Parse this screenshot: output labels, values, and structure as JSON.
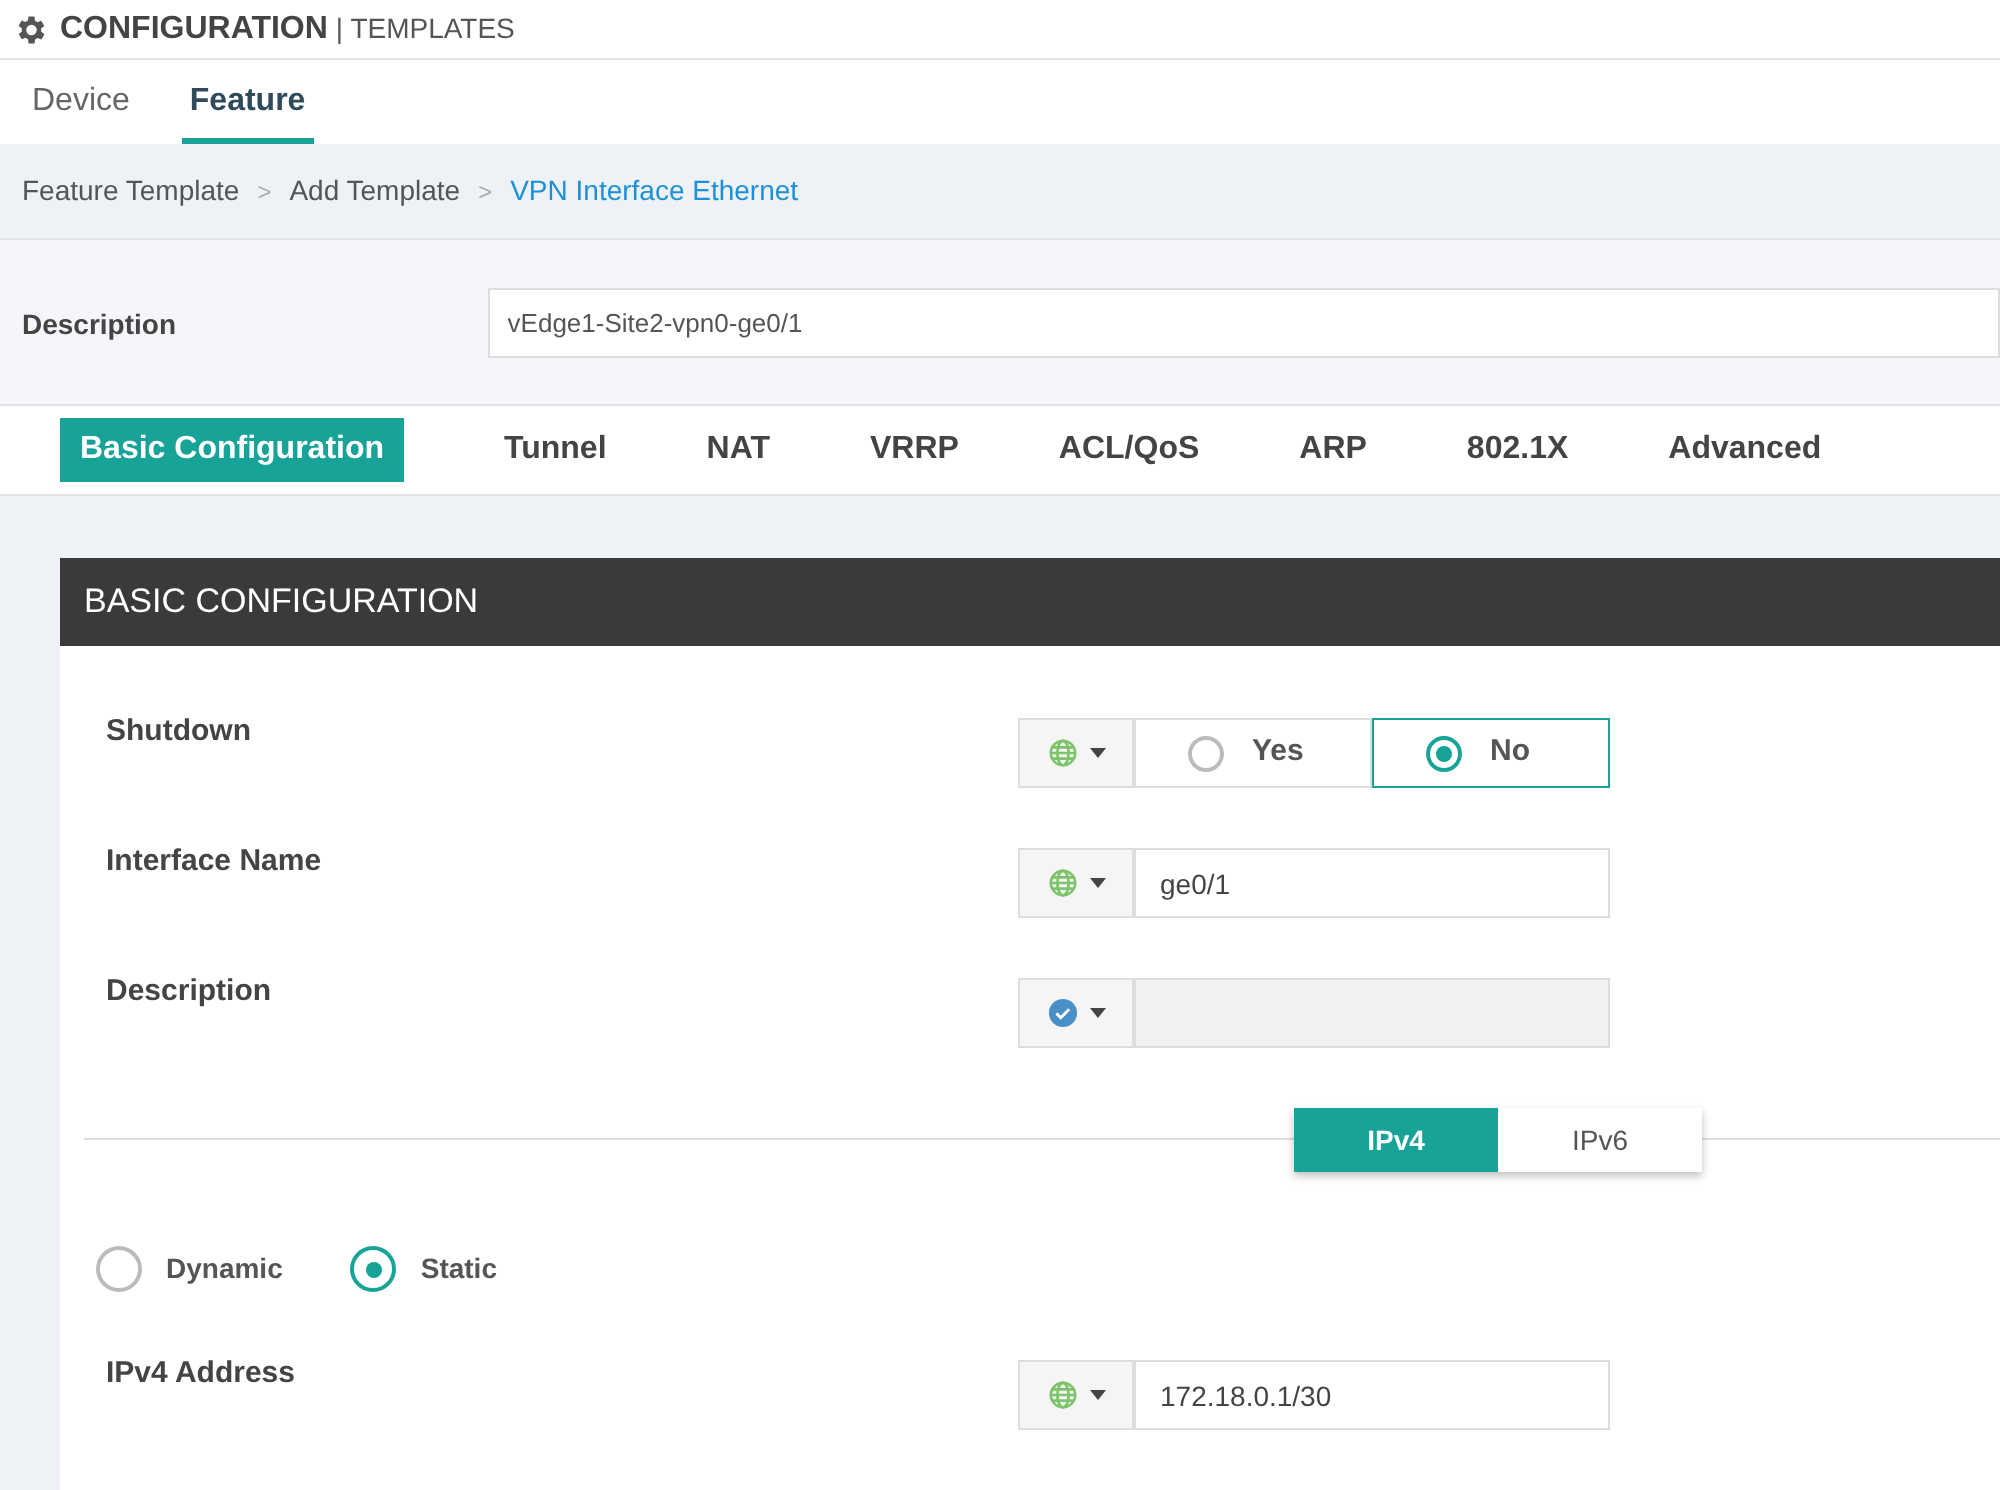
{
  "header": {
    "title": "CONFIGURATION",
    "subtitle": "| TEMPLATES"
  },
  "tabs": [
    {
      "label": "Device",
      "selected": false
    },
    {
      "label": "Feature",
      "selected": true
    }
  ],
  "breadcrumb": {
    "separator": ">",
    "items": [
      {
        "label": "Feature Template",
        "current": false
      },
      {
        "label": "Add Template",
        "current": false
      },
      {
        "label": "VPN Interface Ethernet",
        "current": true
      }
    ]
  },
  "description": {
    "label": "Description",
    "value": "vEdge1-Site2-vpn0-ge0/1"
  },
  "section_tabs": [
    {
      "label": "Basic Configuration",
      "selected": true
    },
    {
      "label": "Tunnel",
      "selected": false
    },
    {
      "label": "NAT",
      "selected": false
    },
    {
      "label": "VRRP",
      "selected": false
    },
    {
      "label": "ACL/QoS",
      "selected": false
    },
    {
      "label": "ARP",
      "selected": false
    },
    {
      "label": "802.1X",
      "selected": false
    },
    {
      "label": "Advanced",
      "selected": false
    }
  ],
  "panel": {
    "title": "BASIC CONFIGURATION",
    "fields": [
      {
        "kind": "radio",
        "label": "Shutdown",
        "global": true,
        "options": [
          {
            "label": "Yes",
            "selected": false
          },
          {
            "label": "No",
            "selected": true
          }
        ]
      },
      {
        "kind": "text",
        "label": "Interface Name",
        "global": true,
        "value": "ge0/1",
        "disabled": false
      },
      {
        "kind": "text",
        "label": "Description",
        "global": false,
        "disabled": true
      }
    ],
    "ip_toggle": [
      {
        "label": "IPv4",
        "selected": true
      },
      {
        "label": "IPv6",
        "selected": false
      }
    ],
    "address_mode": [
      {
        "label": "Dynamic",
        "selected": false
      },
      {
        "label": "Static",
        "selected": true
      }
    ],
    "ip_fields": [
      {
        "kind": "text",
        "label": "IPv4 Address",
        "global": true,
        "value": "172.18.0.1/30",
        "disabled": false
      }
    ]
  }
}
